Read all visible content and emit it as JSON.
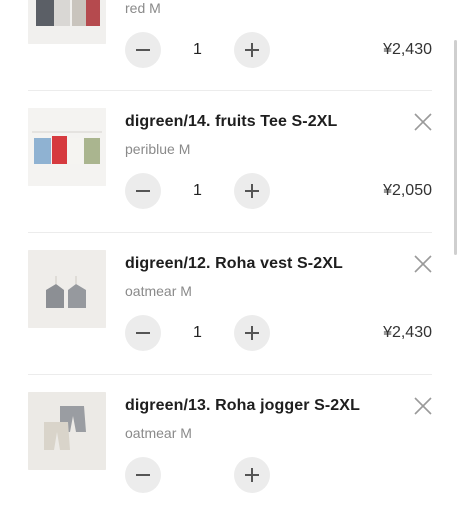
{
  "cart": {
    "currency_symbol": "¥",
    "items": [
      {
        "title": "",
        "variant": "red M",
        "quantity": "1",
        "price": "¥2,430",
        "image": "kids-tops-photo"
      },
      {
        "title": "digreen/14. fruits Tee S-2XL",
        "variant": "periblue M",
        "quantity": "1",
        "price": "¥2,050",
        "image": "fruits-tee-photo"
      },
      {
        "title": "digreen/12. Roha vest S-2XL",
        "variant": "oatmear M",
        "quantity": "1",
        "price": "¥2,430",
        "image": "roha-vest-photo"
      },
      {
        "title": "digreen/13. Roha jogger S-2XL",
        "variant": "oatmear M",
        "quantity": "",
        "price": "",
        "image": "roha-jogger-photo"
      }
    ]
  },
  "icons": {
    "remove": "close-icon",
    "decrement": "minus-icon",
    "increment": "plus-icon"
  },
  "colors": {
    "stepper_bg": "#ececec",
    "divider": "#ececec",
    "variant_text": "#8a8a8a"
  }
}
